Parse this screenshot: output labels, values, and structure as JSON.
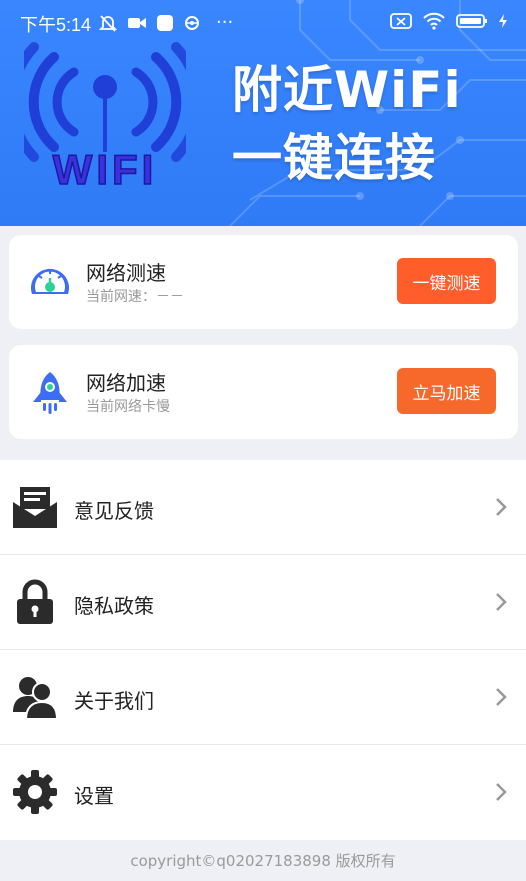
{
  "status_bar": {
    "time": "下午5:14",
    "left_icons": [
      "mute-icon",
      "video-icon",
      "app-icon",
      "gear-small-icon",
      "more-icon"
    ],
    "right_icons": [
      "sim-off-icon",
      "wifi-icon",
      "battery-icon",
      "charging-icon"
    ],
    "more_label": "···"
  },
  "banner": {
    "logo_text": "WIFI",
    "headline_line1": "附近WiFi",
    "headline_line2": "一键连接",
    "bg_color": "#3a86ff"
  },
  "cards": [
    {
      "title": "网络测速",
      "subtitle": "当前网速：－－",
      "button_label": "一键测速",
      "button_color": "#ff5d2a",
      "icon": "speedometer-icon"
    },
    {
      "title": "网络加速",
      "subtitle": "当前网络卡慢",
      "button_label": "立马加速",
      "button_color": "#f7692a",
      "icon": "rocket-icon"
    }
  ],
  "menu": [
    {
      "label": "意见反馈",
      "icon": "feedback-icon"
    },
    {
      "label": "隐私政策",
      "icon": "lock-icon"
    },
    {
      "label": "关于我们",
      "icon": "users-icon"
    },
    {
      "label": "设置",
      "icon": "settings-icon"
    }
  ],
  "footer": "copyright©q02027183898 版权所有"
}
